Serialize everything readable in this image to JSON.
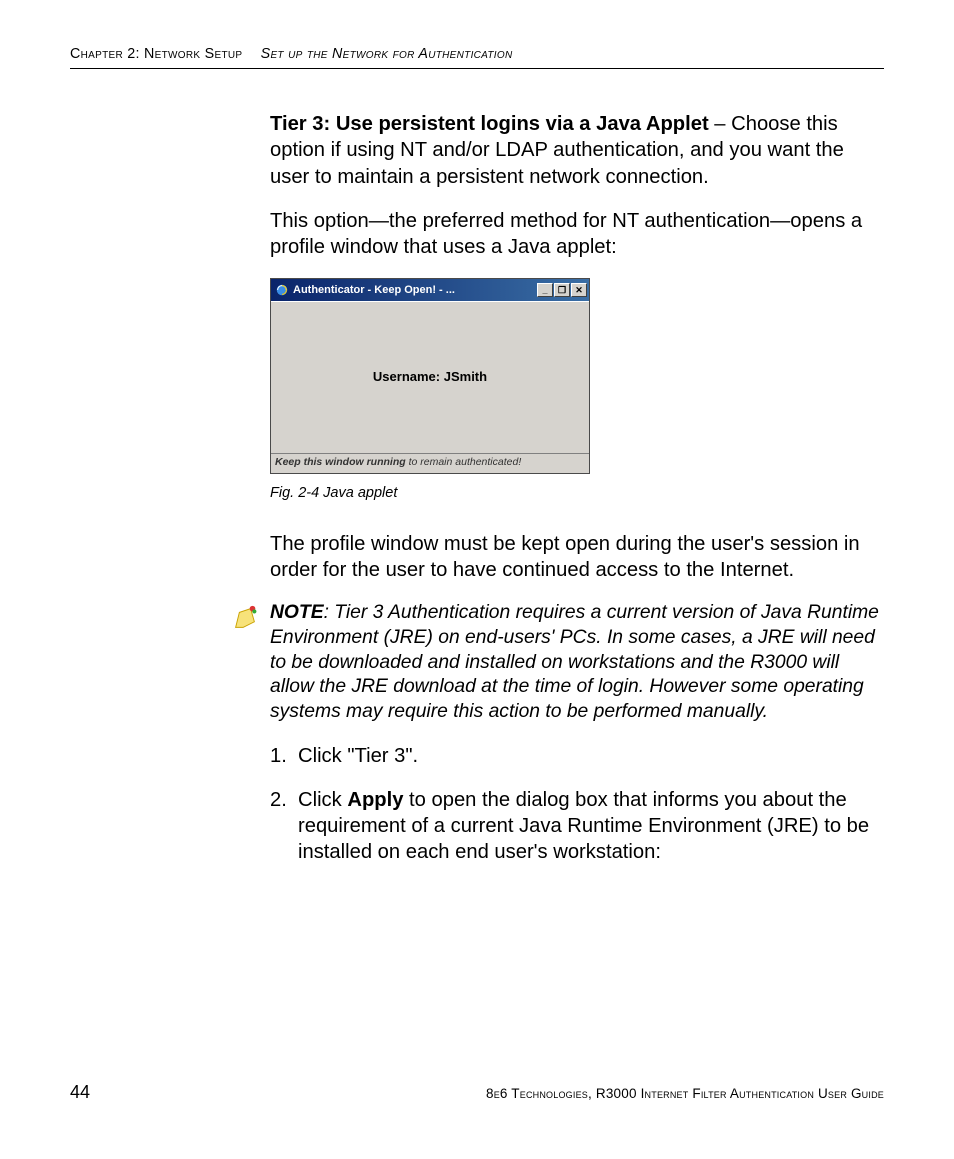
{
  "header": {
    "chapter": "Chapter 2: Network Setup",
    "section": "Set up the Network for Authentication"
  },
  "body": {
    "p1_bold": "Tier 3: Use persistent logins via a Java Applet",
    "p1_rest": " – Choose this option if using NT and/or LDAP authentication, and you want the user to maintain a persistent network connection.",
    "p2": "This option—the preferred method for NT authentication—opens a profile window that uses a Java applet:",
    "p3": "The profile window must be kept open during the user's session in order for the user to have continued access to the Internet."
  },
  "applet": {
    "title": "Authenticator - Keep Open! - ...",
    "min": "_",
    "max": "❐",
    "close": "✕",
    "username_label": "Username: JSmith",
    "status_bold": "Keep this window running",
    "status_rest": " to remain authenticated!"
  },
  "figure_caption": "Fig. 2-4  Java applet",
  "note": {
    "label": "NOTE",
    "text": ": Tier 3 Authentication requires a current version of Java Runtime Environment (JRE) on end-users' PCs. In some cases, a JRE will need to be downloaded and installed on workstations and the R3000 will allow the JRE download at the time of login. However some operating systems may require this action to be performed manually."
  },
  "steps": {
    "s1_num": "1.",
    "s1_text": "Click \"Tier 3\".",
    "s2_num": "2.",
    "s2_a": "Click ",
    "s2_bold": "Apply",
    "s2_b": " to open the dialog box that informs you about the requirement of a current Java Runtime Environment (JRE) to be installed on each end user's workstation:"
  },
  "footer": {
    "page": "44",
    "text": "8e6 Technologies, R3000 Internet Filter Authentication User Guide"
  }
}
